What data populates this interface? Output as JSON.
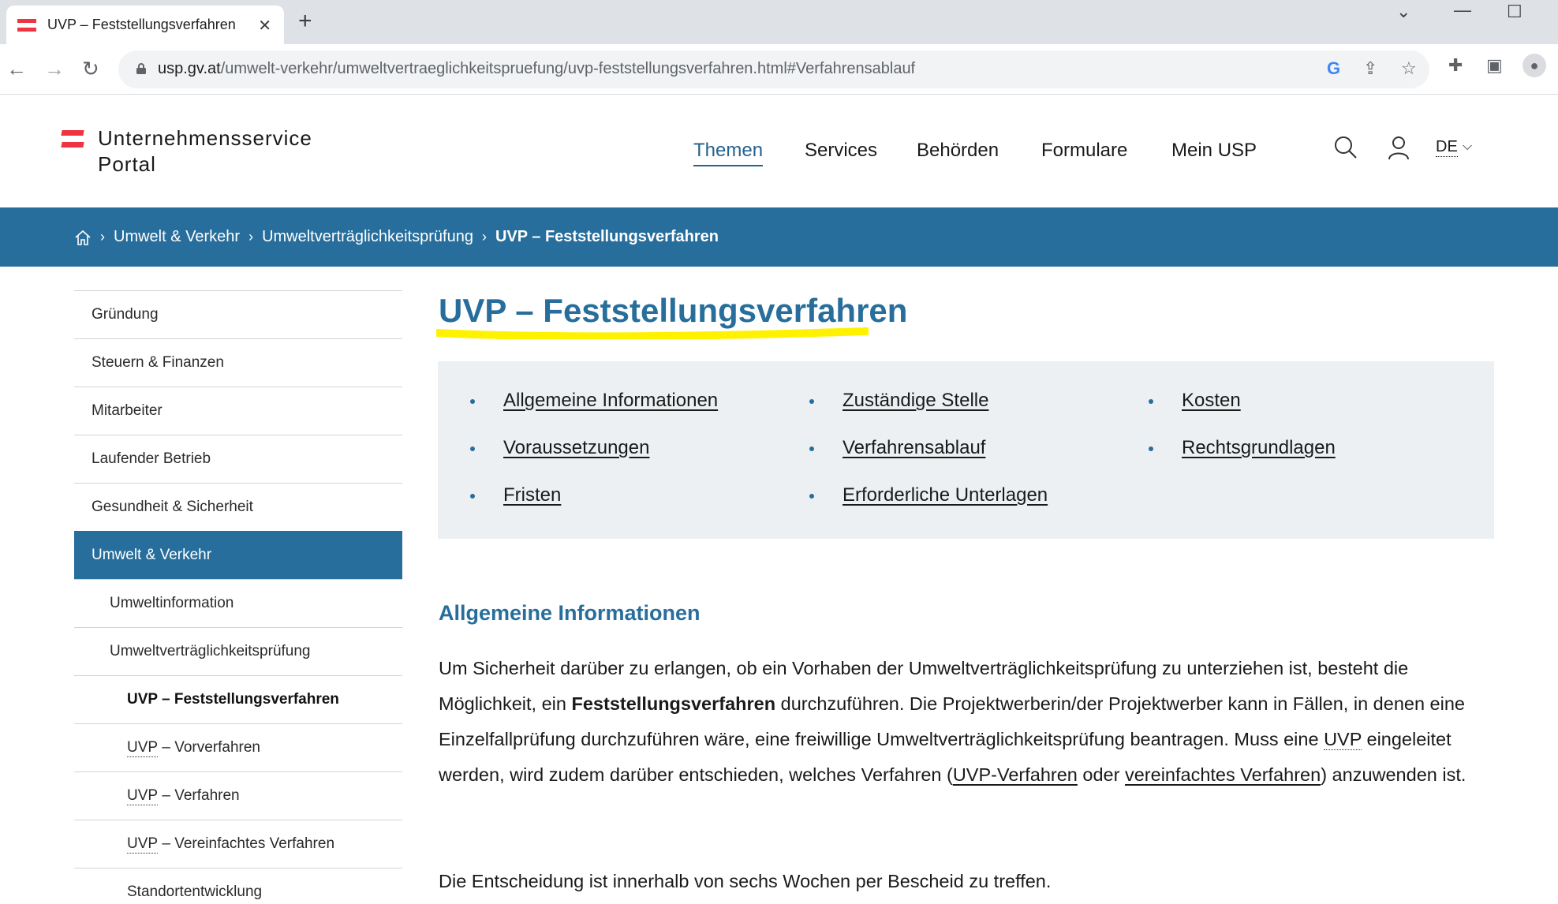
{
  "browser": {
    "tab_title": "UVP – Feststellungsverfahren",
    "url_domain": "usp.gv.at",
    "url_path": "/umwelt-verkehr/umweltvertraeglichkeitspruefung/uvp-feststellungsverfahren.html#Verfahrensablauf"
  },
  "logo": {
    "line1": "Unternehmensservice",
    "line2": "Portal"
  },
  "mainnav": {
    "themen": "Themen",
    "services": "Services",
    "behoerden": "Behörden",
    "formulare": "Formulare",
    "mein_usp": "Mein USP",
    "lang": "DE"
  },
  "breadcrumb": {
    "item1": "Umwelt & Verkehr",
    "item2": "Umweltverträglichkeitsprüfung",
    "item3": "UVP – Feststellungsverfahren"
  },
  "sidebar": {
    "items": [
      "Gründung",
      "Steuern & Finanzen",
      "Mitarbeiter",
      "Laufender Betrieb",
      "Gesundheit & Sicherheit",
      "Umwelt & Verkehr",
      "Umweltinformation",
      "Umweltverträglichkeitsprüfung",
      "UVP – Feststellungsverfahren"
    ],
    "uvp_abbr": "UVP",
    "vorverfahren": " – Vorverfahren",
    "verfahren": " – Verfahren",
    "vereinfachtes": " – Vereinfachtes Verfahren",
    "standort": "Standortentwicklung"
  },
  "main": {
    "title": "UVP – Feststellungsverfahren",
    "toc": [
      "Allgemeine Informationen",
      "Voraussetzungen",
      "Fristen",
      "Zuständige Stelle",
      "Verfahrensablauf",
      "Erforderliche Unterlagen",
      "Kosten",
      "Rechtsgrundlagen"
    ],
    "section_heading": "Allgemeine Informationen",
    "p1_a": "Um Sicherheit darüber zu erlangen, ob ein Vorhaben der Umweltverträglichkeitsprüfung zu unterziehen ist, besteht die Möglichkeit, ein ",
    "p1_bold": "Feststellungsverfahren",
    "p1_b": " durchzuführen. Die Projektwerberin/der Projektwerber kann in Fällen, in denen eine Einzelfallprüfung durchzuführen wäre, eine freiwillige Umweltverträglichkeitsprüfung beantragen. Muss eine ",
    "p1_uvp": "UVP",
    "p1_c": " eingeleitet werden, wird zudem darüber entschieden, welches Verfahren (",
    "p1_link1": "UVP-Verfahren",
    "p1_d": " oder ",
    "p1_link2": "vereinfachtes Verfahren",
    "p1_e": ") anzuwenden ist.",
    "p2": "Die Entscheidung ist innerhalb von sechs Wochen per Bescheid zu treffen."
  },
  "colors": {
    "brand_blue": "#276e9c",
    "austria_red": "#ef3340",
    "highlight_yellow": "#fff200"
  }
}
